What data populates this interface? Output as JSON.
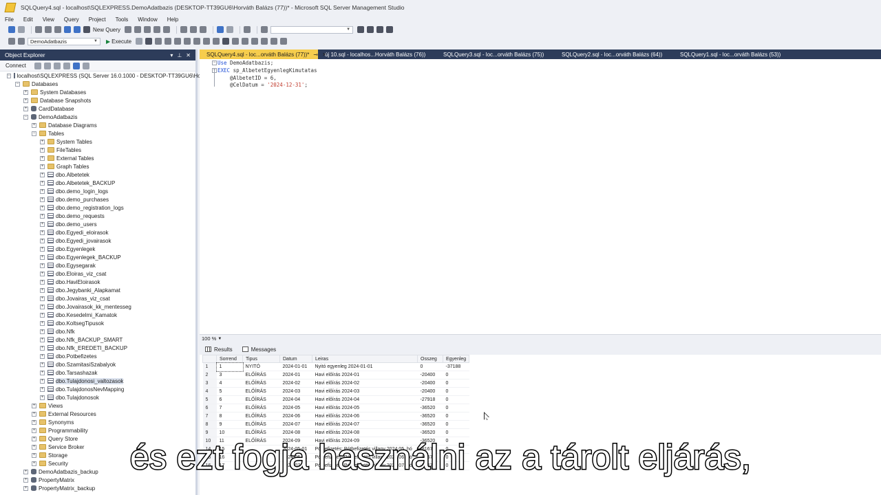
{
  "window": {
    "title": "SQLQuery4.sql - localhost\\SQLEXPRESS.DemoAdatbazis (DESKTOP-TT39GU6\\Horváth Balázs (77))* - Microsoft SQL Server Management Studio"
  },
  "menu": [
    "File",
    "Edit",
    "View",
    "Query",
    "Project",
    "Tools",
    "Window",
    "Help"
  ],
  "toolbar": {
    "new_query": "New Query",
    "database": "DemoAdatbazis",
    "execute": "Execute",
    "search_value": ""
  },
  "object_explorer": {
    "title": "Object Explorer",
    "connect": "Connect",
    "server": "localhost\\SQLEXPRESS (SQL Server 16.0.1000 - DESKTOP-TT39GU6\\Horv",
    "nodes": [
      {
        "label": "Databases",
        "indent": 1,
        "exp": "-",
        "icon": "folder"
      },
      {
        "label": "System Databases",
        "indent": 2,
        "exp": "+",
        "icon": "folder"
      },
      {
        "label": "Database Snapshots",
        "indent": 2,
        "exp": "+",
        "icon": "folder"
      },
      {
        "label": "CardDatabase",
        "indent": 2,
        "exp": "+",
        "icon": "db"
      },
      {
        "label": "DemoAdatbazis",
        "indent": 2,
        "exp": "-",
        "icon": "db"
      },
      {
        "label": "Database Diagrams",
        "indent": 3,
        "exp": "+",
        "icon": "folder"
      },
      {
        "label": "Tables",
        "indent": 3,
        "exp": "-",
        "icon": "folder"
      },
      {
        "label": "System Tables",
        "indent": 4,
        "exp": "+",
        "icon": "folder"
      },
      {
        "label": "FileTables",
        "indent": 4,
        "exp": "+",
        "icon": "folder"
      },
      {
        "label": "External Tables",
        "indent": 4,
        "exp": "+",
        "icon": "folder"
      },
      {
        "label": "Graph Tables",
        "indent": 4,
        "exp": "+",
        "icon": "folder"
      },
      {
        "label": "dbo.Albetetek",
        "indent": 4,
        "exp": "+",
        "icon": "table"
      },
      {
        "label": "dbo.Albetetek_BACKUP",
        "indent": 4,
        "exp": "+",
        "icon": "table"
      },
      {
        "label": "dbo.demo_login_logs",
        "indent": 4,
        "exp": "+",
        "icon": "table"
      },
      {
        "label": "dbo.demo_purchases",
        "indent": 4,
        "exp": "+",
        "icon": "table"
      },
      {
        "label": "dbo.demo_registration_logs",
        "indent": 4,
        "exp": "+",
        "icon": "table"
      },
      {
        "label": "dbo.demo_requests",
        "indent": 4,
        "exp": "+",
        "icon": "table"
      },
      {
        "label": "dbo.demo_users",
        "indent": 4,
        "exp": "+",
        "icon": "table"
      },
      {
        "label": "dbo.Egyedi_eloirasok",
        "indent": 4,
        "exp": "+",
        "icon": "table"
      },
      {
        "label": "dbo.Egyedi_jovairasok",
        "indent": 4,
        "exp": "+",
        "icon": "table"
      },
      {
        "label": "dbo.Egyenlegek",
        "indent": 4,
        "exp": "+",
        "icon": "table"
      },
      {
        "label": "dbo.Egyenlegek_BACKUP",
        "indent": 4,
        "exp": "+",
        "icon": "table"
      },
      {
        "label": "dbo.Egysegarak",
        "indent": 4,
        "exp": "+",
        "icon": "table"
      },
      {
        "label": "dbo.Eloiras_viz_csat",
        "indent": 4,
        "exp": "+",
        "icon": "table"
      },
      {
        "label": "dbo.HaviEloirasok",
        "indent": 4,
        "exp": "+",
        "icon": "table"
      },
      {
        "label": "dbo.Jegybanki_Alapkamat",
        "indent": 4,
        "exp": "+",
        "icon": "table"
      },
      {
        "label": "dbo.Jovairas_viz_csat",
        "indent": 4,
        "exp": "+",
        "icon": "table"
      },
      {
        "label": "dbo.Jovairasok_kk_mentesseg",
        "indent": 4,
        "exp": "+",
        "icon": "table"
      },
      {
        "label": "dbo.Kesedelmi_Kamatok",
        "indent": 4,
        "exp": "+",
        "icon": "table"
      },
      {
        "label": "dbo.KoltsegTipusok",
        "indent": 4,
        "exp": "+",
        "icon": "table"
      },
      {
        "label": "dbo.Nfk",
        "indent": 4,
        "exp": "+",
        "icon": "table"
      },
      {
        "label": "dbo.Nfk_BACKUP_SMART",
        "indent": 4,
        "exp": "+",
        "icon": "table"
      },
      {
        "label": "dbo.Nfk_EREDETI_BACKUP",
        "indent": 4,
        "exp": "+",
        "icon": "table"
      },
      {
        "label": "dbo.Potbefizetes",
        "indent": 4,
        "exp": "+",
        "icon": "table"
      },
      {
        "label": "dbo.SzamitasiSzabalyok",
        "indent": 4,
        "exp": "+",
        "icon": "table"
      },
      {
        "label": "dbo.Tarsashazak",
        "indent": 4,
        "exp": "+",
        "icon": "table"
      },
      {
        "label": "dbo.Tulajdonosi_valtozasok",
        "indent": 4,
        "exp": "+",
        "icon": "table",
        "selected": true
      },
      {
        "label": "dbo.TulajdonosNevMapping",
        "indent": 4,
        "exp": "+",
        "icon": "table"
      },
      {
        "label": "dbo.Tulajdonosok",
        "indent": 4,
        "exp": "+",
        "icon": "table"
      },
      {
        "label": "Views",
        "indent": 3,
        "exp": "+",
        "icon": "folder"
      },
      {
        "label": "External Resources",
        "indent": 3,
        "exp": "+",
        "icon": "folder"
      },
      {
        "label": "Synonyms",
        "indent": 3,
        "exp": "+",
        "icon": "folder"
      },
      {
        "label": "Programmability",
        "indent": 3,
        "exp": "+",
        "icon": "folder"
      },
      {
        "label": "Query Store",
        "indent": 3,
        "exp": "+",
        "icon": "folder"
      },
      {
        "label": "Service Broker",
        "indent": 3,
        "exp": "+",
        "icon": "folder"
      },
      {
        "label": "Storage",
        "indent": 3,
        "exp": "+",
        "icon": "folder"
      },
      {
        "label": "Security",
        "indent": 3,
        "exp": "+",
        "icon": "folder"
      },
      {
        "label": "DemoAdatbazis_backup",
        "indent": 2,
        "exp": "+",
        "icon": "db"
      },
      {
        "label": "PropertyMatrix",
        "indent": 2,
        "exp": "+",
        "icon": "db"
      },
      {
        "label": "PropertyMatrix_backup",
        "indent": 2,
        "exp": "+",
        "icon": "db"
      }
    ]
  },
  "tabs": [
    {
      "label": "SQLQuery4.sql - loc...orváth Balázs (77))*",
      "active": true
    },
    {
      "label": "új 10.sql - localhos...Horváth Balázs (76))",
      "active": false
    },
    {
      "label": "SQLQuery3.sql - loc...orváth Balázs (75))",
      "active": false
    },
    {
      "label": "SQLQuery2.sql - loc...orváth Balázs (64))",
      "active": false
    },
    {
      "label": "SQLQuery1.sql - loc...orváth Balázs (53))",
      "active": false
    }
  ],
  "editor": {
    "line1_kw": "Use",
    "line1_rest": " DemoAdatbazis;",
    "line2_kw": "EXEC",
    "line2_rest": " sp_AlbetetEgyenlegKimutatas",
    "line3": "    @AlbetetID = 6,",
    "line4_pre": "    @CelDatum = ",
    "line4_str": "'2024-12-31'",
    "line4_post": ";"
  },
  "zoom": "100 %",
  "results_tabs": {
    "results": "Results",
    "messages": "Messages"
  },
  "grid": {
    "columns": [
      "Sorrend",
      "Tipus",
      "Datum",
      "Leiras",
      "Osszeg",
      "Egyenleg"
    ],
    "rows": [
      [
        "1",
        "1",
        "NYITÓ",
        "2024-01-01",
        "Nyitó egyenleg 2024-01-01",
        "0",
        "-37188"
      ],
      [
        "2",
        "3",
        "ELŐÍRÁS",
        "2024-01",
        "Havi előírás 2024-01",
        "-20400",
        "0"
      ],
      [
        "3",
        "4",
        "ELŐÍRÁS",
        "2024-02",
        "Havi előírás 2024-02",
        "-20400",
        "0"
      ],
      [
        "4",
        "5",
        "ELŐÍRÁS",
        "2024-03",
        "Havi előírás 2024-03",
        "-20400",
        "0"
      ],
      [
        "5",
        "6",
        "ELŐÍRÁS",
        "2024-04",
        "Havi előírás 2024-04",
        "-27918",
        "0"
      ],
      [
        "6",
        "7",
        "ELŐÍRÁS",
        "2024-05",
        "Havi előírás 2024-05",
        "-36520",
        "0"
      ],
      [
        "7",
        "8",
        "ELŐÍRÁS",
        "2024-06",
        "Havi előírás 2024-06",
        "-36520",
        "0"
      ],
      [
        "8",
        "9",
        "ELŐÍRÁS",
        "2024-07",
        "Havi előírás 2024-07",
        "-36520",
        "0"
      ],
      [
        "9",
        "10",
        "ELŐÍRÁS",
        "2024-08",
        "Havi előírás 2024-08",
        "-36520",
        "0"
      ],
      [
        "10",
        "11",
        "ELŐÍRÁS",
        "2024-09",
        "Havi előírás 2024-09",
        "-36520",
        "0"
      ],
      [
        "14",
        "15",
        "",
        "2024-05-01",
        "Pótbefizetés: Pótbefizetés villany 2024.05. hó",
        "-8167",
        "0"
      ],
      [
        "15",
        "16",
        "",
        "2024-06-01",
        "Pótbefizetés: Pótbefizetés villany 2024.06. hó",
        "-8167",
        "0"
      ],
      [
        "16",
        "17",
        "",
        "2024-07-01",
        "Pótbefizetés: Pótbefizetés villany 2024.07. hó",
        "-8167",
        "0"
      ]
    ]
  },
  "subtitle": "és ezt fogja használni az a tárolt eljárás,"
}
